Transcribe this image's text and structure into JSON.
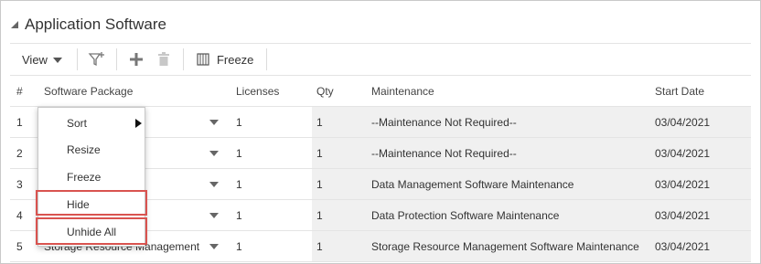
{
  "panel": {
    "title": "Application Software"
  },
  "toolbar": {
    "view_label": "View",
    "freeze_label": "Freeze"
  },
  "grid": {
    "columns": [
      "#",
      "Software Package",
      "Licenses",
      "Qty",
      "Maintenance",
      "Start Date"
    ],
    "rows": [
      {
        "num": "1",
        "package": "",
        "licenses": "1",
        "qty": "1",
        "maintenance": "--Maintenance Not Required--",
        "start_date": "03/04/2021"
      },
      {
        "num": "2",
        "package": "",
        "licenses": "1",
        "qty": "1",
        "maintenance": "--Maintenance Not Required--",
        "start_date": "03/04/2021"
      },
      {
        "num": "3",
        "package": "",
        "licenses": "1",
        "qty": "1",
        "maintenance": "Data Management Software Maintenance",
        "start_date": "03/04/2021"
      },
      {
        "num": "4",
        "package": "",
        "licenses": "1",
        "qty": "1",
        "maintenance": "Data Protection Software Maintenance",
        "start_date": "03/04/2021"
      },
      {
        "num": "5",
        "package": "Storage Resource Management",
        "licenses": "1",
        "qty": "1",
        "maintenance": "Storage Resource Management Software Maintenance",
        "start_date": "03/04/2021"
      }
    ]
  },
  "context_menu": {
    "items": [
      "Sort",
      "Resize",
      "Freeze",
      "Hide",
      "Unhide All"
    ]
  },
  "colors": {
    "highlight_border": "#d9534f",
    "readonly_cell_bg": "#f0f0f0"
  }
}
